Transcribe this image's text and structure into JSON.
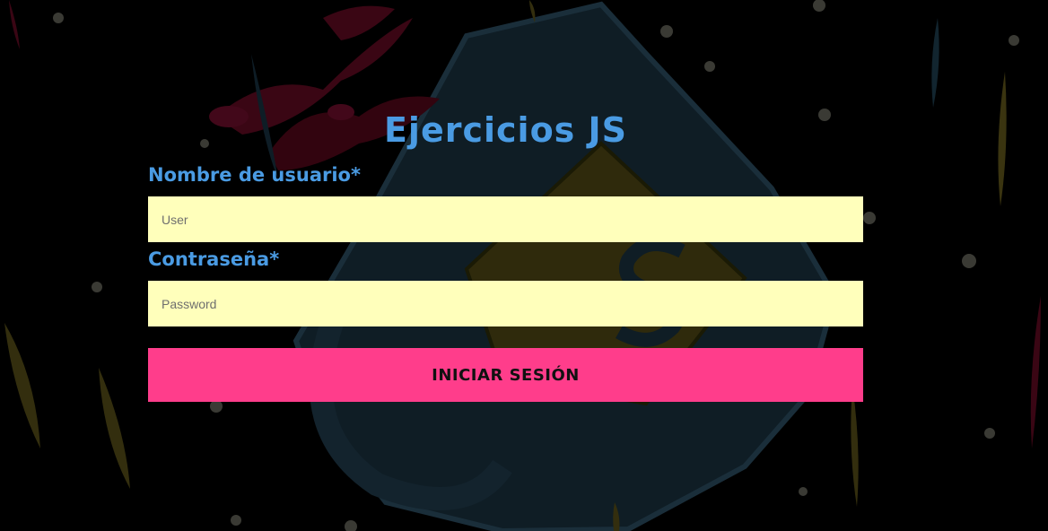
{
  "page": {
    "title": "Ejercicios JS",
    "background_description_icon": "js-shield-background"
  },
  "form": {
    "username_label": "Nombre de usuario",
    "username_required": "*",
    "username_placeholder": "User",
    "username_value": "",
    "password_label": "Contraseña",
    "password_required": "*",
    "password_placeholder": "Password",
    "password_value": "",
    "submit_label": "INICIAR SESIÓN"
  },
  "colors": {
    "background": "#000000",
    "accent_blue": "#4a9be3",
    "input_bg": "#ffffbb",
    "button_bg": "#ff3d8b"
  }
}
